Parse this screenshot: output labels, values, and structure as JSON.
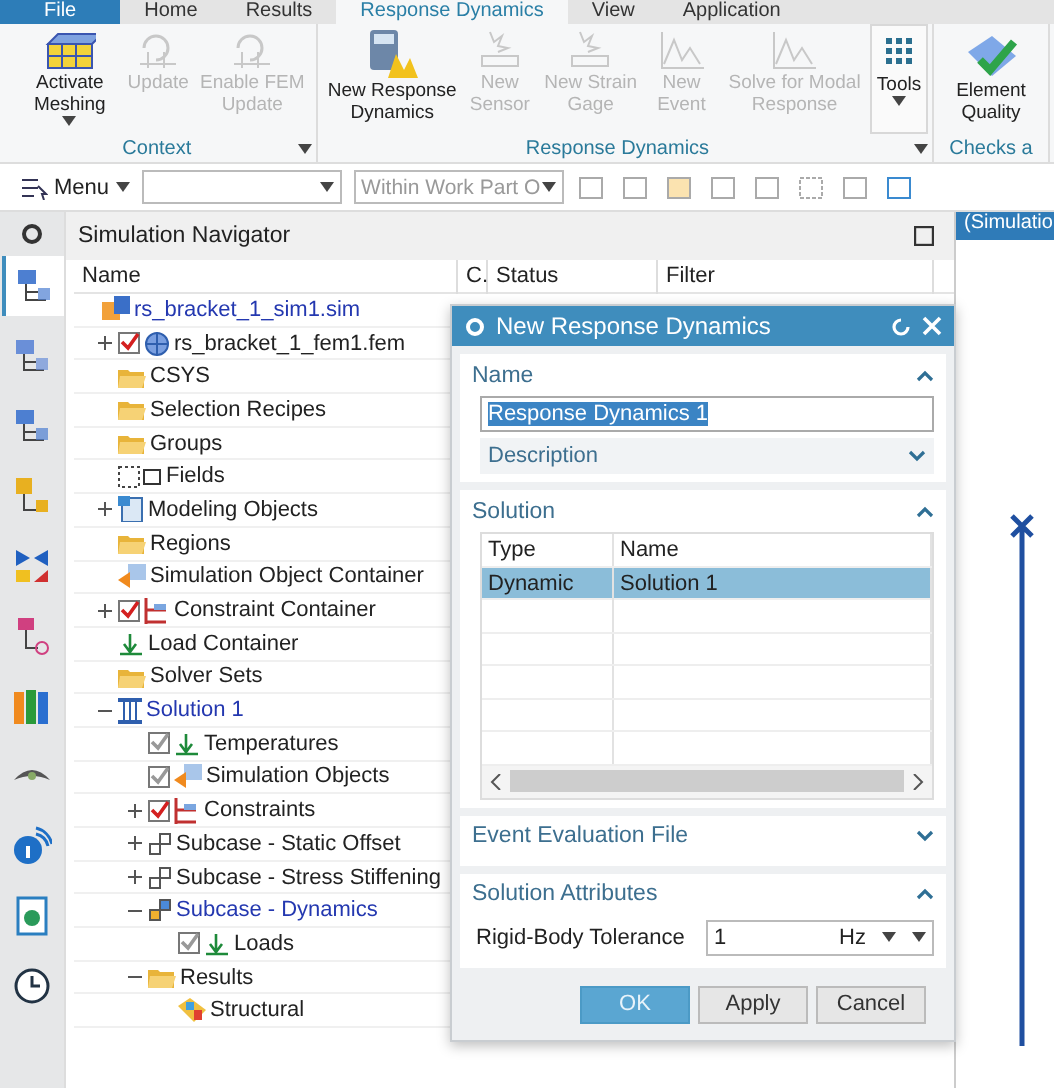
{
  "ribbon_tabs": [
    {
      "label": "File",
      "selected": false,
      "kind": "file"
    },
    {
      "label": "Home",
      "selected": false,
      "kind": "tab"
    },
    {
      "label": "Results",
      "selected": false,
      "kind": "tab"
    },
    {
      "label": "Response Dynamics",
      "selected": true,
      "kind": "tab"
    },
    {
      "label": "View",
      "selected": false,
      "kind": "tab"
    },
    {
      "label": "Application",
      "selected": false,
      "kind": "tab"
    }
  ],
  "ribbon_groups": [
    {
      "label": "Context",
      "launcher": true,
      "buttons": [
        {
          "label": "Activate Meshing",
          "kind": "mesh",
          "disabled": false,
          "dropdown": true
        },
        {
          "label": "Update",
          "kind": "update",
          "disabled": true,
          "dropdown": false
        },
        {
          "label": "Enable FEM Update",
          "kind": "update",
          "disabled": true,
          "dropdown": false
        }
      ]
    },
    {
      "label": "Response Dynamics",
      "launcher": true,
      "buttons": [
        {
          "label": "New Response Dynamics",
          "kind": "calc",
          "disabled": false,
          "dropdown": false
        },
        {
          "label": "New Sensor",
          "kind": "sensor",
          "disabled": true,
          "dropdown": false
        },
        {
          "label": "New Strain Gage",
          "kind": "sensor",
          "disabled": true,
          "dropdown": false
        },
        {
          "label": "New Event",
          "kind": "graph",
          "disabled": true,
          "dropdown": false
        },
        {
          "label": "Solve for Modal Response",
          "kind": "graph",
          "disabled": true,
          "dropdown": false
        },
        {
          "label": "Tools",
          "kind": "grid",
          "disabled": false,
          "dropdown": true
        }
      ]
    },
    {
      "label": "Checks a",
      "launcher": false,
      "buttons": [
        {
          "label": "Element Quality",
          "kind": "quality",
          "disabled": false,
          "dropdown": false
        }
      ]
    }
  ],
  "toolbar": {
    "menu": "Menu",
    "scope_filter": "Within Work Part O"
  },
  "sidebar_tabs": [
    {
      "selected": true,
      "kind": "tree"
    },
    {
      "selected": false,
      "kind": "tree"
    },
    {
      "selected": false,
      "kind": "tree"
    },
    {
      "selected": false,
      "kind": "parts"
    },
    {
      "selected": false,
      "kind": "bowtie"
    },
    {
      "selected": false,
      "kind": "node"
    },
    {
      "selected": false,
      "kind": "books"
    },
    {
      "selected": false,
      "kind": "eye"
    },
    {
      "selected": false,
      "kind": "info"
    },
    {
      "selected": false,
      "kind": "document"
    },
    {
      "selected": false,
      "kind": "clock"
    }
  ],
  "navigator": {
    "title": "Simulation Navigator",
    "columns": [
      "Name",
      "C.",
      "Status",
      "Filter"
    ],
    "tree": [
      {
        "label": "rs_bracket_1_sim1.sim",
        "kind": "sim",
        "active": true,
        "children": [
          {
            "label": "rs_bracket_1_fem1.fem",
            "kind": "fem",
            "active": false,
            "expanded": false,
            "checked": true,
            "dimmed": false
          },
          {
            "label": "CSYS",
            "kind": "folder",
            "active": false
          },
          {
            "label": "Selection Recipes",
            "kind": "folder",
            "active": false
          },
          {
            "label": "Groups",
            "kind": "folder",
            "active": false
          },
          {
            "label": "Fields",
            "kind": "fields",
            "active": false
          },
          {
            "label": "Modeling Objects",
            "kind": "modeling",
            "active": false,
            "expanded": false
          },
          {
            "label": "Regions",
            "kind": "folder",
            "active": false
          },
          {
            "label": "Simulation Object Container",
            "kind": "simobj",
            "active": false
          },
          {
            "label": "Constraint Container",
            "kind": "constraint",
            "active": false,
            "expanded": false,
            "checked": true,
            "dimmed": false
          },
          {
            "label": "Load Container",
            "kind": "load",
            "active": false
          },
          {
            "label": "Solver Sets",
            "kind": "folder",
            "active": false
          },
          {
            "label": "Solution 1",
            "kind": "solution",
            "active": true,
            "expanded": true,
            "children": [
              {
                "label": "Temperatures",
                "kind": "load",
                "active": false,
                "checked": true,
                "dimmed": true
              },
              {
                "label": "Simulation Objects",
                "kind": "simobj",
                "active": false,
                "checked": true,
                "dimmed": true
              },
              {
                "label": "Constraints",
                "kind": "constraint",
                "active": false,
                "expanded": false,
                "checked": true,
                "dimmed": false
              },
              {
                "label": "Subcase - Static Offset",
                "kind": "subcase",
                "active": false,
                "expanded": false
              },
              {
                "label": "Subcase - Stress Stiffening",
                "kind": "subcase",
                "active": false,
                "expanded": false
              },
              {
                "label": "Subcase - Dynamics",
                "kind": "subcase-active",
                "active": true,
                "expanded": true,
                "children": [
                  {
                    "label": "Loads",
                    "kind": "load",
                    "active": false,
                    "checked": true,
                    "dimmed": true
                  }
                ]
              },
              {
                "label": "Results",
                "kind": "folder",
                "active": false,
                "expanded": true,
                "children": [
                  {
                    "label": "Structural",
                    "kind": "results",
                    "active": false
                  }
                ]
              }
            ]
          }
        ]
      }
    ]
  },
  "dialog": {
    "title": "New Response Dynamics",
    "sections": [
      {
        "kind": "name",
        "title": "Name",
        "expanded": true,
        "value": "Response Dynamics 1",
        "value_selected": true,
        "description": {
          "label": "Description",
          "expanded": false
        }
      },
      {
        "kind": "table",
        "title": "Solution",
        "expanded": true,
        "columns": [
          "Type",
          "Name"
        ],
        "rows": [
          {
            "cells": [
              "Dynamic",
              "Solution 1"
            ],
            "selected": true
          }
        ]
      },
      {
        "kind": "plain",
        "title": "Event Evaluation File",
        "expanded": false
      },
      {
        "kind": "attributes",
        "title": "Solution Attributes",
        "expanded": true,
        "fields": [
          {
            "label": "Rigid-Body Tolerance",
            "value": "1",
            "unit": "Hz"
          }
        ]
      }
    ],
    "buttons": [
      {
        "label": "OK",
        "primary": true
      },
      {
        "label": "Apply",
        "primary": false
      },
      {
        "label": "Cancel",
        "primary": false
      }
    ]
  },
  "graphics": {
    "tab": "(Simulatio"
  }
}
